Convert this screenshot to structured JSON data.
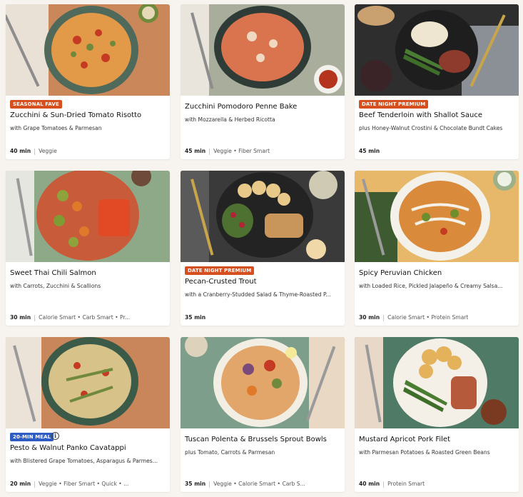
{
  "recipes": [
    {
      "badge": "SEASONAL FAVE",
      "title": "Zucchini & Sun-Dried Tomato Risotto",
      "subtitle": "with Grape Tomatoes & Parmesan",
      "time": "40 min",
      "tags": "Veggie"
    },
    {
      "badge": "",
      "title": "Zucchini Pomodoro Penne Bake",
      "subtitle": "with Mozzarella & Herbed Ricotta",
      "time": "45 min",
      "tags": "Veggie • Fiber Smart"
    },
    {
      "badge": "DATE NIGHT PREMIUM",
      "title": "Beef Tenderloin with Shallot Sauce",
      "subtitle": "plus Honey-Walnut Crostini & Chocolate Bundt Cakes",
      "time": "45 min",
      "tags": ""
    },
    {
      "badge": "",
      "title": "Sweet Thai Chili Salmon",
      "subtitle": "with Carrots, Zucchini & Scallions",
      "time": "30 min",
      "tags": "Calorie Smart • Carb Smart • Pr..."
    },
    {
      "badge": "DATE NIGHT PREMIUM",
      "title": "Pecan-Crusted Trout",
      "subtitle": "with a Cranberry-Studded Salad & Thyme-Roasted P...",
      "time": "35 min",
      "tags": ""
    },
    {
      "badge": "",
      "title": "Spicy Peruvian Chicken",
      "subtitle": "with Loaded Rice, Pickled Jalapeño & Creamy Salsa...",
      "time": "30 min",
      "tags": "Calorie Smart • Protein Smart"
    },
    {
      "badge": "20-MIN MEAL",
      "title": "Pesto & Walnut Panko Cavatappi",
      "subtitle": "with Blistered Grape Tomatoes, Asparagus & Parmes...",
      "time": "20 min",
      "tags": "Veggie • Fiber Smart • Quick • ..."
    },
    {
      "badge": "",
      "title": "Tuscan Polenta & Brussels Sprout Bowls",
      "subtitle": "plus Tomato, Carrots & Parmesan",
      "time": "35 min",
      "tags": "Veggie • Calorie Smart • Carb S..."
    },
    {
      "badge": "",
      "title": "Mustard Apricot Pork Filet",
      "subtitle": "with Parmesan Potatoes & Roasted Green Beans",
      "time": "40 min",
      "tags": "Protein Smart"
    }
  ],
  "colors": {
    "badge_premium": "#d64f1e",
    "badge_fast": "#2f5cc2"
  },
  "icons": {
    "info": "info-icon"
  }
}
